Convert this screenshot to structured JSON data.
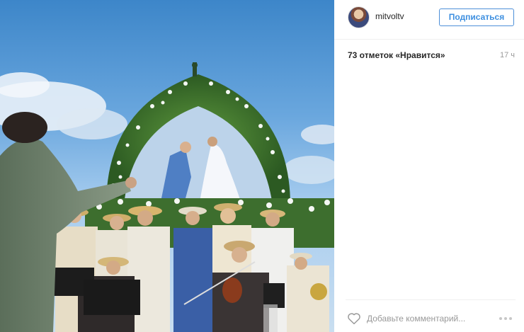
{
  "post": {
    "photo_icon": "wedding-concert-photo",
    "username": "mitvoltv",
    "follow_label": "Подписаться",
    "likes": "73 отметок «Нравится»",
    "time": "17 ч",
    "comment_placeholder": "Добавьте комментарий...",
    "like_icon": "heart-icon",
    "more_icon": "ellipsis-icon"
  },
  "colors": {
    "accent": "#3d8fe0",
    "border": "#efefef",
    "muted": "#999999"
  }
}
